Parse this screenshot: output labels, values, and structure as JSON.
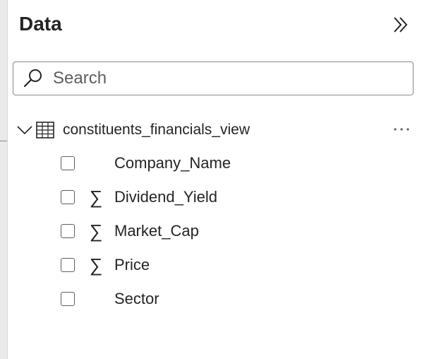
{
  "pane": {
    "title": "Data",
    "collapse_icon": "double-chevron-right-icon"
  },
  "search": {
    "placeholder": "Search",
    "value": ""
  },
  "table": {
    "name": "constituents_financials_view",
    "expanded": true,
    "more_label": "···",
    "fields": [
      {
        "name": "Company_Name",
        "aggregate": false,
        "checked": false
      },
      {
        "name": "Dividend_Yield",
        "aggregate": true,
        "checked": false
      },
      {
        "name": "Market_Cap",
        "aggregate": true,
        "checked": false
      },
      {
        "name": "Price",
        "aggregate": true,
        "checked": false
      },
      {
        "name": "Sector",
        "aggregate": false,
        "checked": false
      }
    ],
    "sigma_glyph": "∑"
  },
  "colors": {
    "pane_bg": "#ffffff",
    "text": "#252423",
    "border": "#8a8886"
  }
}
